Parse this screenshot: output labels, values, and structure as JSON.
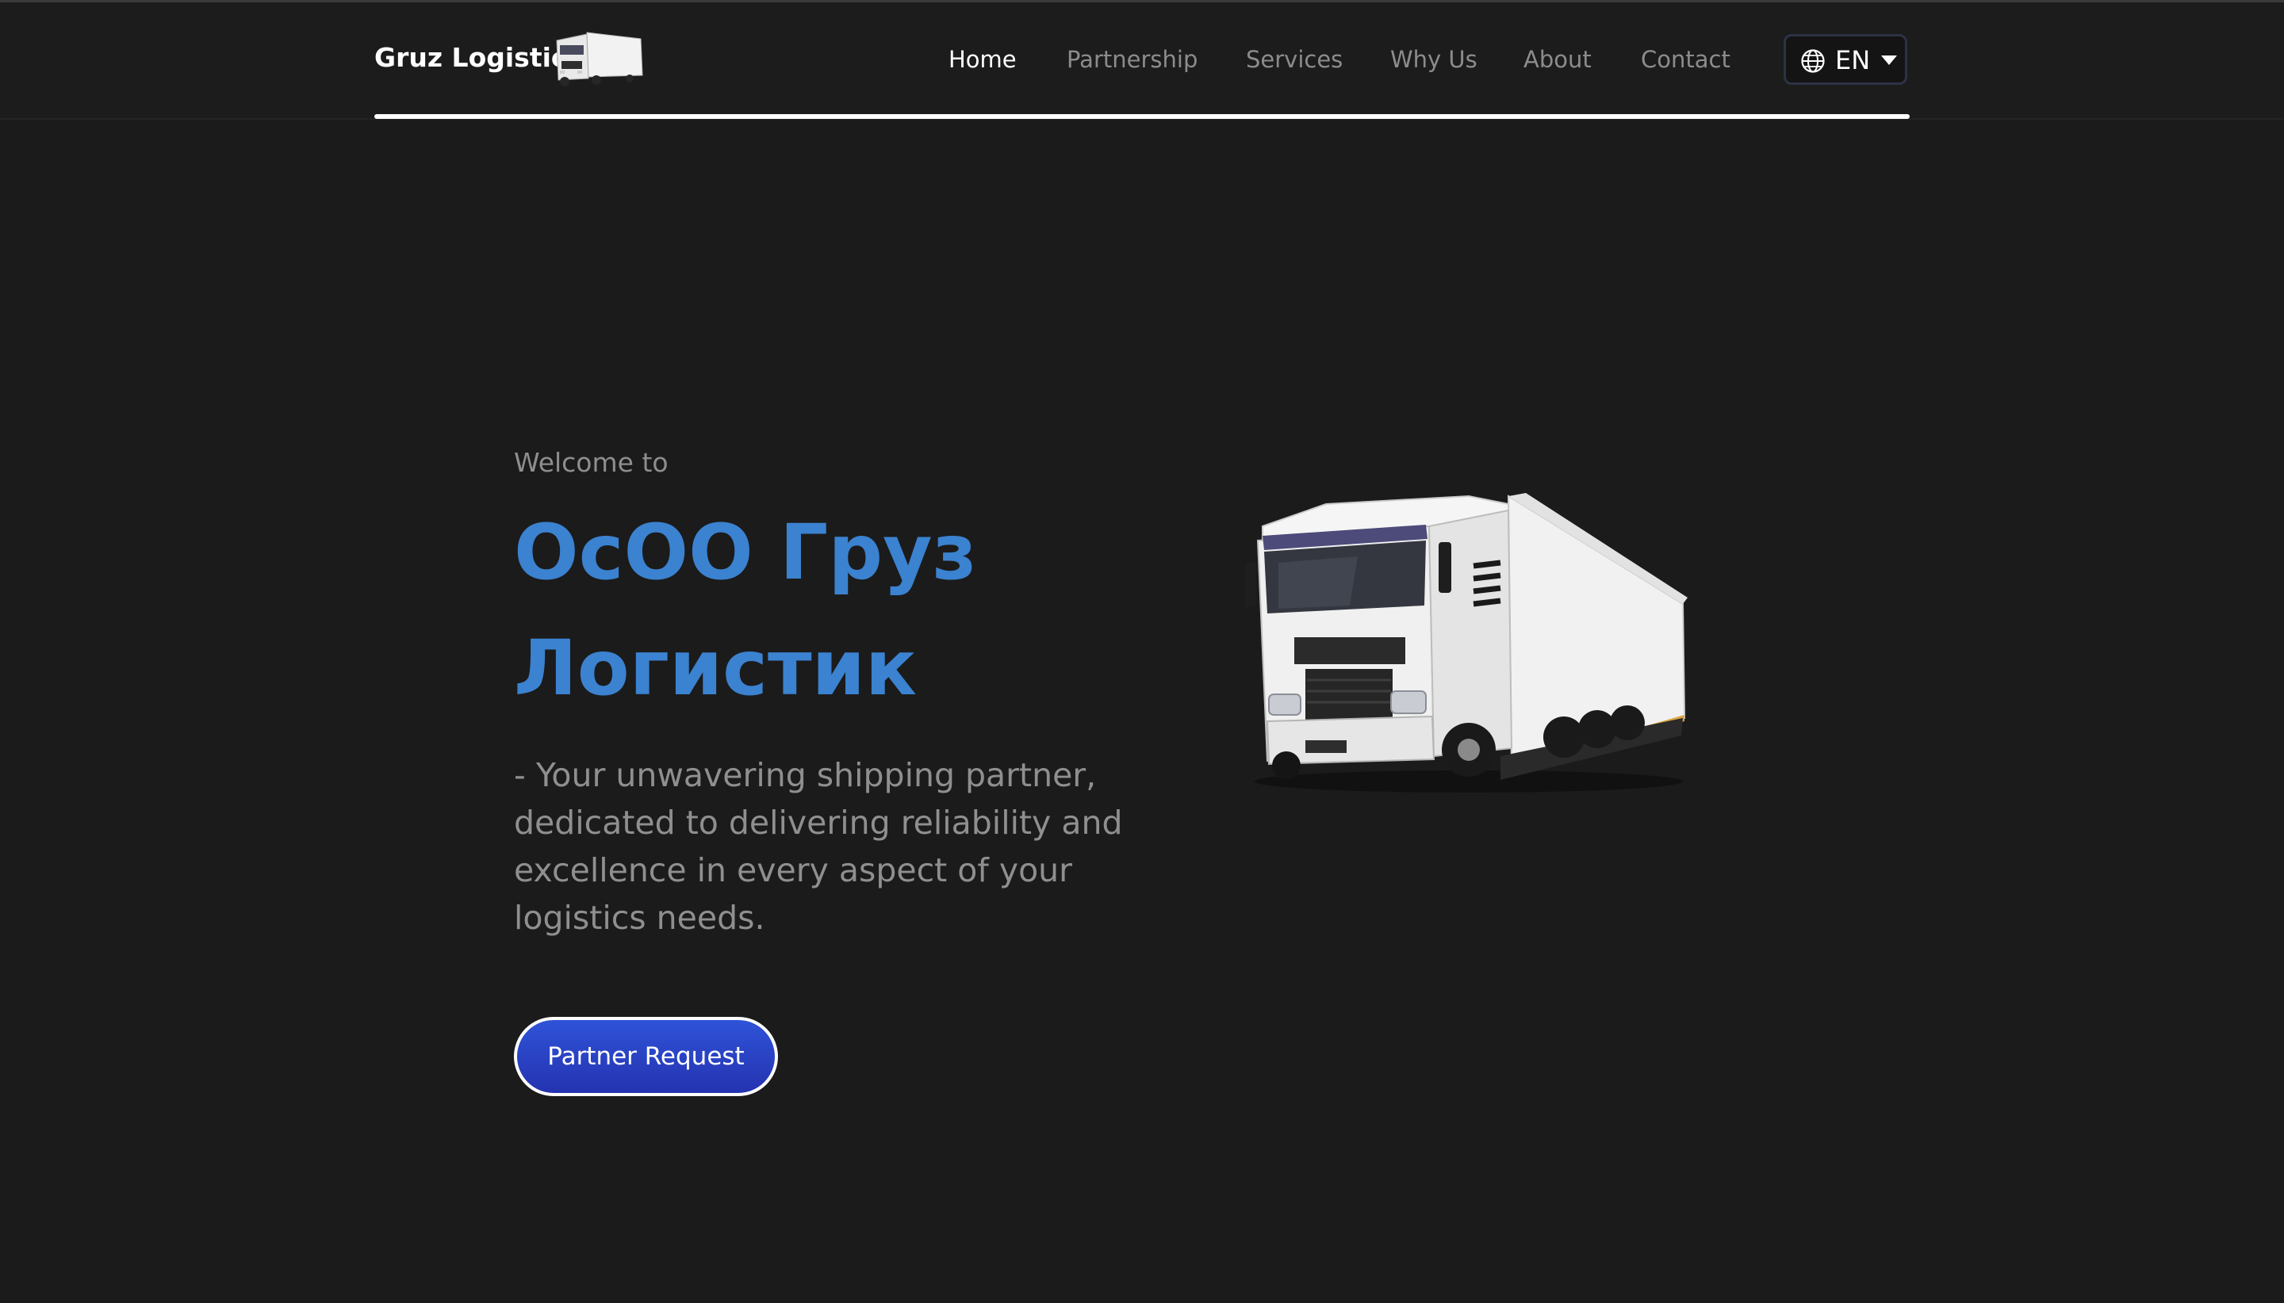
{
  "header": {
    "brand": "Gruz Logistic",
    "nav": [
      {
        "label": "Home",
        "active": true
      },
      {
        "label": "Partnership",
        "active": false
      },
      {
        "label": "Services",
        "active": false
      },
      {
        "label": "Why Us",
        "active": false
      },
      {
        "label": "About",
        "active": false
      },
      {
        "label": "Contact",
        "active": false
      }
    ],
    "language": {
      "code": "EN",
      "icon": "globe-icon"
    }
  },
  "hero": {
    "welcome": "Welcome to",
    "title_line1": "ОсОО Груз",
    "title_line2": "Логистик",
    "subtitle": "- Your unwavering shipping partner, dedicated to delivering reliability and excellence in every aspect of your logistics needs.",
    "cta_label": "Partner Request",
    "image": "truck-image"
  },
  "colors": {
    "background": "#1b1b1b",
    "accent": "#3b82d0",
    "button": "#2a3dc4",
    "nav_inactive": "#8c8c8c",
    "text_muted": "#8f8f8f"
  }
}
